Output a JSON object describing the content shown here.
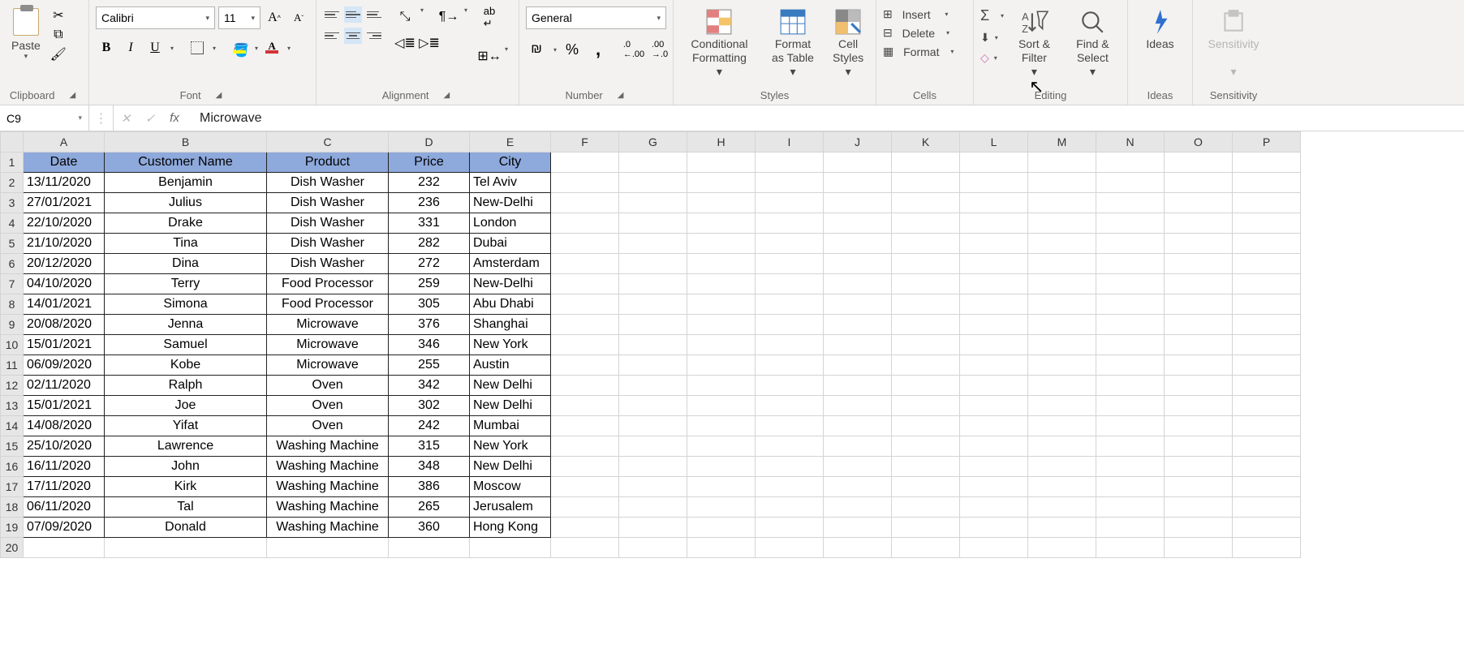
{
  "ribbon": {
    "clipboard": {
      "label": "Clipboard",
      "paste": "Paste"
    },
    "font": {
      "label": "Font",
      "name": "Calibri",
      "size": "11",
      "bold": "B",
      "italic": "I",
      "underline": "U"
    },
    "alignment": {
      "label": "Alignment"
    },
    "number": {
      "label": "Number",
      "format": "General",
      "percent": "%",
      "comma": ","
    },
    "styles": {
      "label": "Styles",
      "conditional": "Conditional Formatting",
      "formatAs": "Format as Table",
      "cell": "Cell Styles"
    },
    "cells": {
      "label": "Cells",
      "insert": "Insert",
      "delete": "Delete",
      "format": "Format"
    },
    "editing": {
      "label": "Editing",
      "sum": "Σ",
      "sort": "Sort & Filter",
      "find": "Find & Select"
    },
    "ideas": {
      "label": "Ideas",
      "btn": "Ideas"
    },
    "sensitivity": {
      "label": "Sensitivity",
      "btn": "Sensitivity"
    }
  },
  "formulaBar": {
    "nameBox": "C9",
    "fx": "fx",
    "value": "Microwave"
  },
  "columns": [
    "A",
    "B",
    "C",
    "D",
    "E",
    "F",
    "G",
    "H",
    "I",
    "J",
    "K",
    "L",
    "M",
    "N",
    "O",
    "P"
  ],
  "headers": [
    "Date",
    "Customer Name",
    "Product",
    "Price",
    "City"
  ],
  "rows": [
    {
      "n": 1
    },
    {
      "n": 2,
      "d": [
        "13/11/2020",
        "Benjamin",
        "Dish Washer",
        "232",
        "Tel Aviv"
      ]
    },
    {
      "n": 3,
      "d": [
        "27/01/2021",
        "Julius",
        "Dish Washer",
        "236",
        "New-Delhi"
      ]
    },
    {
      "n": 4,
      "d": [
        "22/10/2020",
        "Drake",
        "Dish Washer",
        "331",
        "London"
      ]
    },
    {
      "n": 5,
      "d": [
        "21/10/2020",
        "Tina",
        "Dish Washer",
        "282",
        "Dubai"
      ]
    },
    {
      "n": 6,
      "d": [
        "20/12/2020",
        "Dina",
        "Dish Washer",
        "272",
        "Amsterdam"
      ]
    },
    {
      "n": 7,
      "d": [
        "04/10/2020",
        "Terry",
        "Food Processor",
        "259",
        "New-Delhi"
      ]
    },
    {
      "n": 8,
      "d": [
        "14/01/2021",
        "Simona",
        "Food Processor",
        "305",
        "Abu Dhabi"
      ]
    },
    {
      "n": 9,
      "d": [
        "20/08/2020",
        "Jenna",
        "Microwave",
        "376",
        "Shanghai"
      ]
    },
    {
      "n": 10,
      "d": [
        "15/01/2021",
        "Samuel",
        "Microwave",
        "346",
        "New York"
      ]
    },
    {
      "n": 11,
      "d": [
        "06/09/2020",
        "Kobe",
        "Microwave",
        "255",
        "Austin"
      ]
    },
    {
      "n": 12,
      "d": [
        "02/11/2020",
        "Ralph",
        "Oven",
        "342",
        "New Delhi"
      ]
    },
    {
      "n": 13,
      "d": [
        "15/01/2021",
        "Joe",
        "Oven",
        "302",
        "New Delhi"
      ]
    },
    {
      "n": 14,
      "d": [
        "14/08/2020",
        "Yifat",
        "Oven",
        "242",
        "Mumbai"
      ]
    },
    {
      "n": 15,
      "d": [
        "25/10/2020",
        "Lawrence",
        "Washing Machine",
        "315",
        "New York"
      ]
    },
    {
      "n": 16,
      "d": [
        "16/11/2020",
        "John",
        "Washing Machine",
        "348",
        "New Delhi"
      ]
    },
    {
      "n": 17,
      "d": [
        "17/11/2020",
        "Kirk",
        "Washing Machine",
        "386",
        "Moscow"
      ]
    },
    {
      "n": 18,
      "d": [
        "06/11/2020",
        "Tal",
        "Washing Machine",
        "265",
        "Jerusalem"
      ]
    },
    {
      "n": 19,
      "d": [
        "07/09/2020",
        "Donald",
        "Washing Machine",
        "360",
        "Hong Kong"
      ]
    },
    {
      "n": 20
    }
  ]
}
